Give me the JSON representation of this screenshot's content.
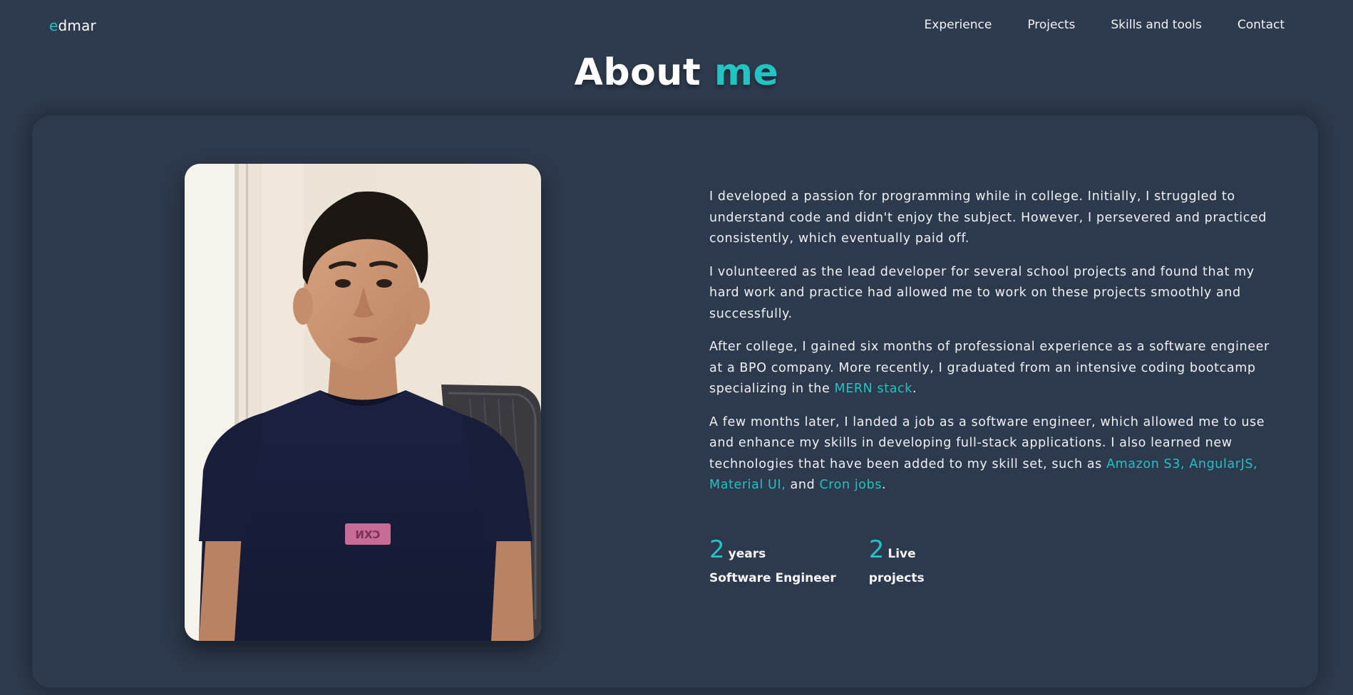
{
  "nav": {
    "logo_first": "e",
    "logo_rest": "dmar",
    "links": [
      "Experience",
      "Projects",
      "Skills and tools",
      "Contact"
    ]
  },
  "heading": {
    "main": "About",
    "accent": "me"
  },
  "bio": {
    "p1": "I developed a passion for programming while in college. Initially, I struggled to understand code and didn't enjoy the subject. However, I persevered and practiced consistently, which eventually paid off.",
    "p2": "I volunteered as the lead developer for several school projects and found that my hard work and practice had allowed me to work on these projects smoothly and successfully.",
    "p3_before": "After college, I gained six months of professional experience as a software engineer at a BPO company. More recently, I graduated from an intensive coding bootcamp specializing in the ",
    "p3_link": "MERN stack",
    "p3_after": ".",
    "p4_before": "A few months later, I landed a job as a software engineer, which allowed me to use and enhance my skills in developing full-stack applications. I also learned new technologies that have been added to my skill set, such as ",
    "p4_link1": "Amazon S3, AngularJS, Material UI,",
    "p4_mid": " and ",
    "p4_link2": "Cron jobs",
    "p4_after": "."
  },
  "stats": [
    {
      "number": "2",
      "unit": "years",
      "label": "Software Engineer"
    },
    {
      "number": "2",
      "unit": "Live",
      "label": "projects"
    }
  ],
  "colors": {
    "background": "#2e3a4d",
    "accent": "#22c3c3",
    "text": "#ffffff"
  }
}
